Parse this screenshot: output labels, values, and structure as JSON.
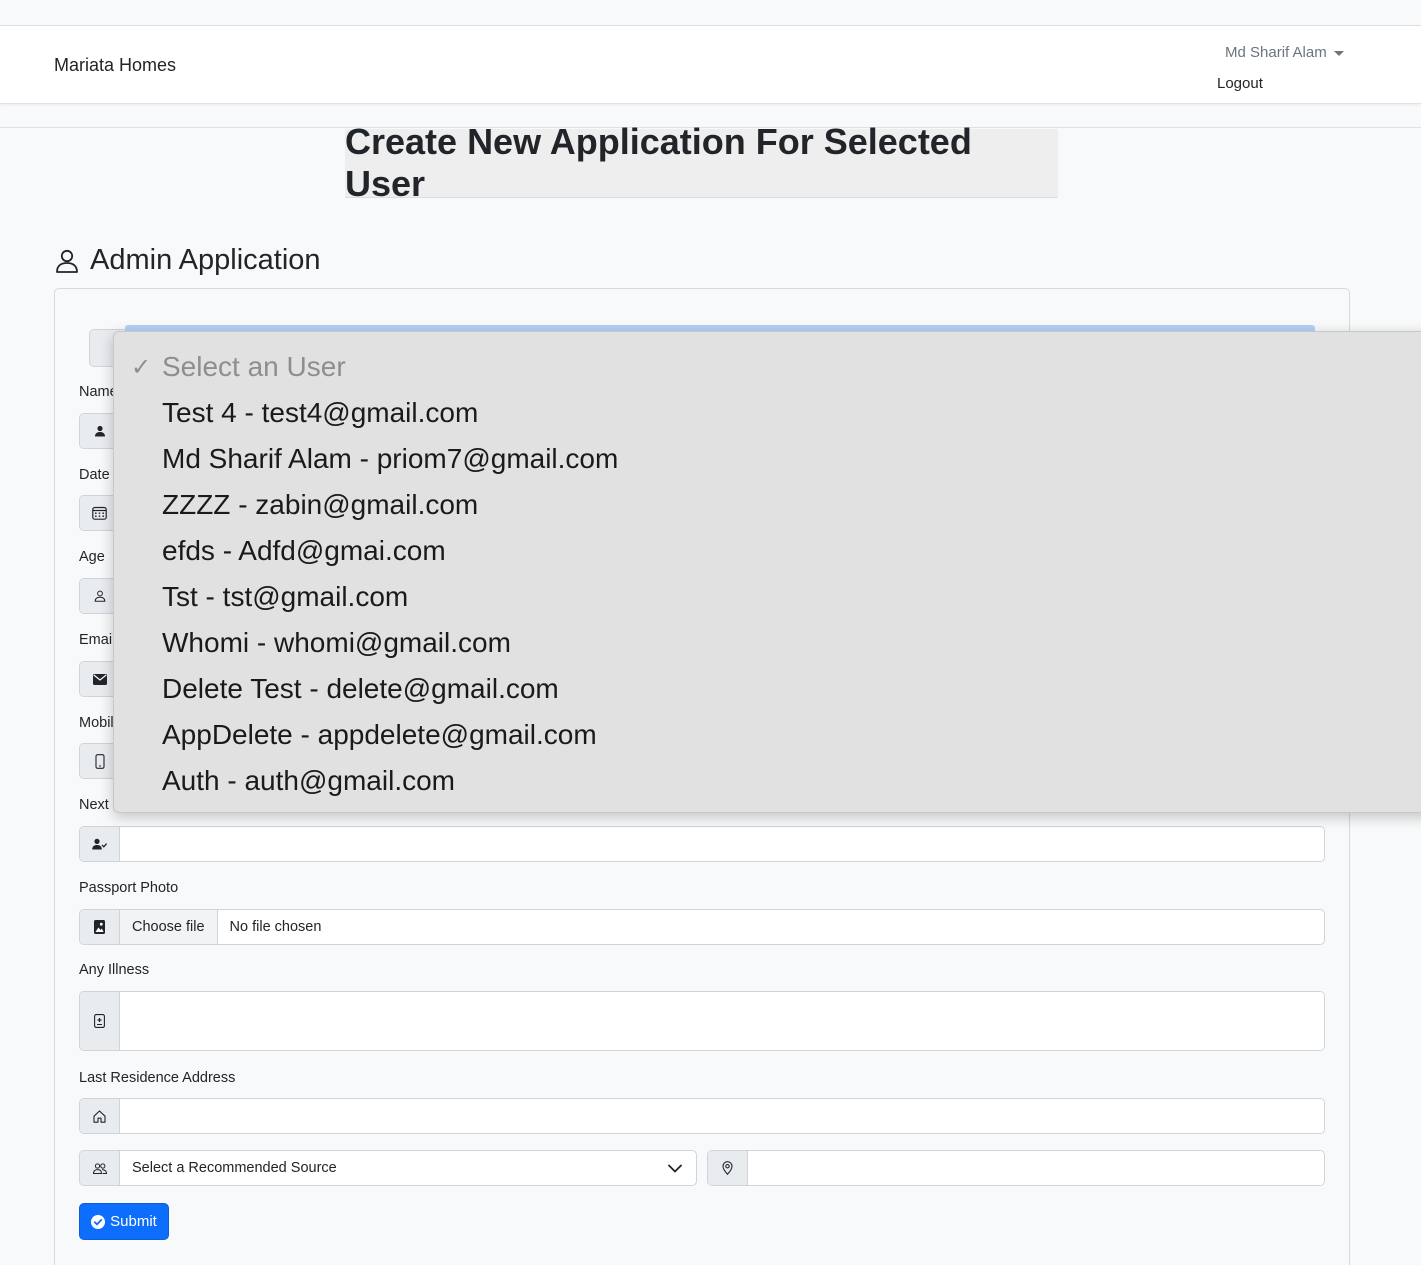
{
  "header": {
    "brand": "Mariata Homes",
    "user_name": "Md Sharif Alam",
    "logout": "Logout"
  },
  "page": {
    "title": "Create New Application For Selected User",
    "section_title": "Admin Application"
  },
  "form": {
    "labels": {
      "name": "Name",
      "date": "Date",
      "age": "Age",
      "email": "Email",
      "mobile": "Mobil",
      "next": "Next",
      "passport_photo": "Passport Photo",
      "any_illness": "Any Illness",
      "last_residence": "Last Residence Address"
    },
    "file_button": "Choose file",
    "file_status": "No file chosen",
    "source_select": "Select a Recommended Source",
    "submit": "Submit"
  },
  "user_dropdown": {
    "placeholder": "Select an User",
    "options": [
      "Test 4 - test4@gmail.com",
      "Md Sharif Alam - priom7@gmail.com",
      "ZZZZ - zabin@gmail.com",
      "efds - Adfd@gmai.com",
      "Tst - tst@gmail.com",
      "Whomi - whomi@gmail.com",
      "Delete Test - delete@gmail.com",
      "AppDelete - appdelete@gmail.com",
      "Auth - auth@gmail.com"
    ]
  },
  "colors": {
    "primary": "#0d6efd",
    "dropdown_bg": "#e1e1e1",
    "addon_bg": "#e9ecef"
  }
}
